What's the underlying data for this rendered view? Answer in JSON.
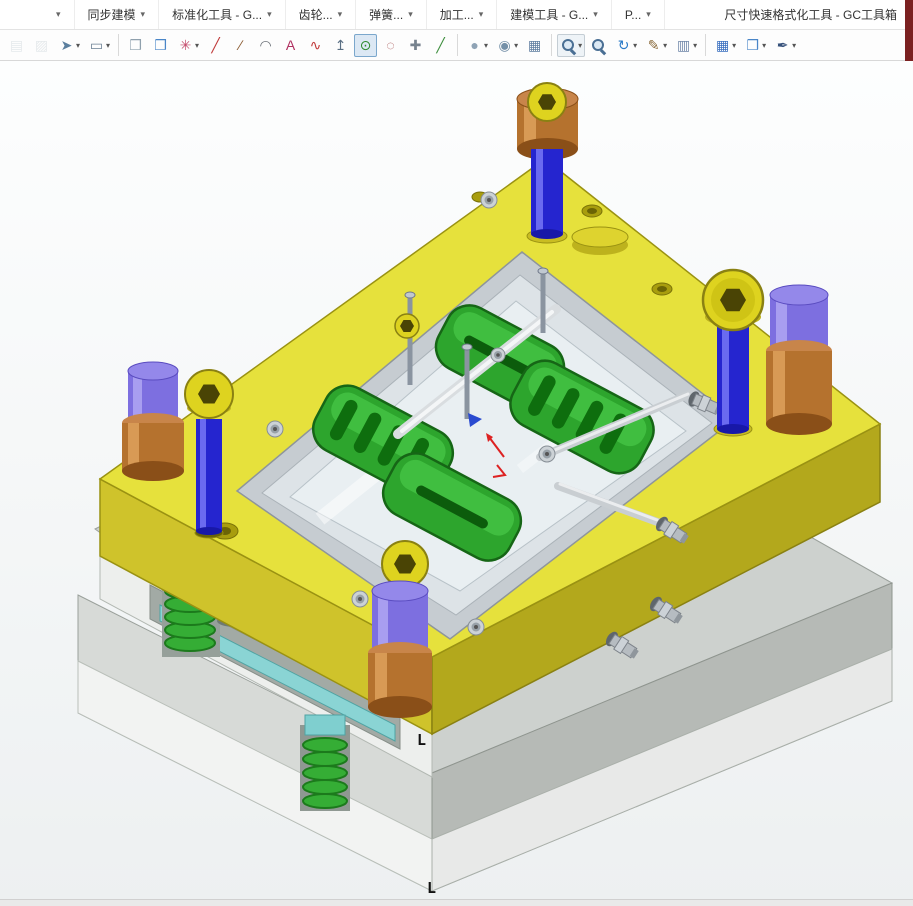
{
  "window": {
    "edge_accent_color": "#7b2121"
  },
  "menu_bar": {
    "items": [
      {
        "name": "menu-stub",
        "label": "",
        "dropdown": true
      },
      {
        "name": "menu-tab-synchronous-modeling",
        "label": "同步建模",
        "dropdown": true
      },
      {
        "name": "menu-tab-standard-tools",
        "label": "标准化工具 - G...",
        "dropdown": true
      },
      {
        "name": "menu-tab-gear",
        "label": "齿轮...",
        "dropdown": true
      },
      {
        "name": "menu-tab-spring",
        "label": "弹簧...",
        "dropdown": true
      },
      {
        "name": "menu-tab-machining",
        "label": "加工...",
        "dropdown": true
      },
      {
        "name": "menu-tab-modeling-tools",
        "label": "建模工具 - G...",
        "dropdown": true
      },
      {
        "name": "menu-tab-more",
        "label": "P...",
        "dropdown": true
      },
      {
        "name": "menu-label-gc-toolbox",
        "label": "尺寸快速格式化工具 - GC工具箱",
        "dropdown": false,
        "align": "right"
      }
    ]
  },
  "toolbar": {
    "items": [
      {
        "name": "paste-icon",
        "glyph": "▤",
        "color": "#c3ccd2",
        "disabled": true
      },
      {
        "name": "format-brush-icon",
        "glyph": "▨",
        "color": "#c3ccd2",
        "disabled": true
      },
      {
        "name": "snap-point-icon",
        "glyph": "➤",
        "color": "#5b7f9e",
        "dropdown": true
      },
      {
        "name": "marquee-select-icon",
        "glyph": "▭",
        "color": "#6a7f93",
        "dropdown": true
      },
      {
        "type": "sep"
      },
      {
        "name": "extrude-cube-icon",
        "glyph": "❒",
        "color": "#8fa0ad"
      },
      {
        "name": "shaded-cube-icon",
        "glyph": "❒",
        "color": "#4a86c8"
      },
      {
        "name": "point-set-icon",
        "glyph": "✳",
        "color": "#c44a6a",
        "dropdown": true
      },
      {
        "name": "line-icon",
        "glyph": "╱",
        "color": "#c03a3a"
      },
      {
        "name": "profile-line-icon",
        "glyph": "∕",
        "color": "#8a5a30"
      },
      {
        "name": "arc-icon",
        "glyph": "◠",
        "color": "#6a6f76"
      },
      {
        "name": "fit-spline-icon",
        "glyph": "A",
        "color": "#b03060"
      },
      {
        "name": "studio-spline-icon",
        "glyph": "∿",
        "color": "#c03a3a"
      },
      {
        "name": "datum-axis-icon",
        "glyph": "↥",
        "color": "#5a6f84"
      },
      {
        "name": "circle-center-icon",
        "glyph": "⊙",
        "color": "#2e8b2e",
        "active": true
      },
      {
        "name": "ellipse-icon",
        "glyph": "◌",
        "color": "#a04848"
      },
      {
        "name": "point-plus-icon",
        "glyph": "✚",
        "color": "#76828e"
      },
      {
        "name": "sketch-line-icon",
        "glyph": "╱",
        "color": "#3f8f3f"
      },
      {
        "type": "sep"
      },
      {
        "name": "sphere-icon",
        "glyph": "●",
        "color": "#8fa3b5",
        "dropdown": true
      },
      {
        "name": "blend-icon",
        "glyph": "◉",
        "color": "#7490a8",
        "dropdown": true
      },
      {
        "name": "datum-grid-icon",
        "glyph": "▦",
        "color": "#5f7da0"
      },
      {
        "type": "sep"
      },
      {
        "name": "zoom-window-icon",
        "css": "magnifier",
        "dropdown": true,
        "framed": true
      },
      {
        "name": "zoom-fit-icon",
        "css": "magnifier"
      },
      {
        "name": "rotate-view-icon",
        "glyph": "↻",
        "color": "#2b7bc8",
        "dropdown": true
      },
      {
        "name": "edit-display-icon",
        "glyph": "✎",
        "color": "#8a6a3a",
        "dropdown": true
      },
      {
        "name": "annotation-icon",
        "glyph": "▥",
        "color": "#6f86a8",
        "dropdown": true
      },
      {
        "type": "sep"
      },
      {
        "name": "part-table-icon",
        "glyph": "▦",
        "color": "#3a6fc0",
        "dropdown": true
      },
      {
        "name": "assembly-cube-icon",
        "glyph": "❒",
        "color": "#4a86c8",
        "dropdown": true
      },
      {
        "name": "style-pen-icon",
        "glyph": "✒",
        "color": "#35507a",
        "dropdown": true
      }
    ]
  },
  "viewport": {
    "corner_mark": "L",
    "background_top": "#fdfefe",
    "background_bottom": "#edf0f1",
    "model_colors": {
      "plate_yellow": "#e6e13c",
      "plate_yellow_side": "#b3a81c",
      "part_green": "#2da52d",
      "guide_pin_blue": "#2525cf",
      "pin_cap_purple": "#7d6fe0",
      "bushing_copper": "#b5722e",
      "spring_green": "#35ad35",
      "ejector_plate_cyan": "#8ad4d4",
      "base_gray": "#d7dad7",
      "bolt_yellow": "#ded31f"
    }
  }
}
